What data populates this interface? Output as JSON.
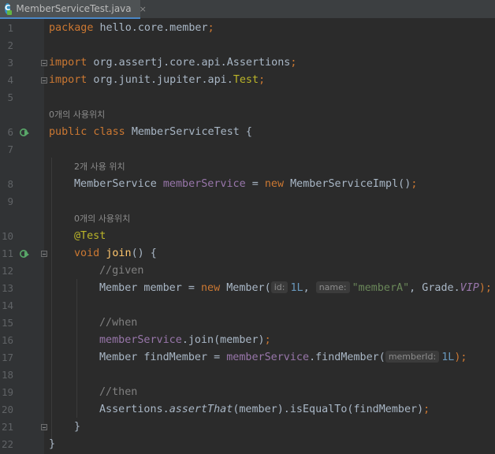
{
  "tab": {
    "title": "MemberServiceTest.java",
    "close": "×",
    "icon": "C"
  },
  "lines": {
    "n1": "1",
    "n2": "2",
    "n3": "3",
    "n4": "4",
    "n5": "5",
    "n6": "6",
    "n7": "7",
    "n8": "8",
    "n9": "9",
    "n10": "10",
    "n11": "11",
    "n12": "12",
    "n13": "13",
    "n14": "14",
    "n15": "15",
    "n16": "16",
    "n17": "17",
    "n18": "18",
    "n19": "19",
    "n20": "20",
    "n21": "21",
    "n22": "22"
  },
  "code": {
    "package_kw": "package",
    "package_name": " hello.core.member",
    "import_kw": "import",
    "import1": " org.assertj.core.api.Assertions",
    "import2_pkg": " org.junit.jupiter.api.",
    "import2_cls": "Test",
    "semi": ";",
    "usage_class": "0개의 사용위치",
    "public_class": "public class ",
    "class_name": "MemberServiceTest {",
    "usage_field": "2개 사용 위치",
    "field_type": "MemberService ",
    "field_name": "memberService",
    "eq": " = ",
    "new_kw": "new ",
    "impl": "MemberServiceImpl()",
    "usage_method": "0개의 사용위치",
    "annotation": "@Test",
    "void_kw": "void ",
    "method_name": "join",
    "method_rest": "() {",
    "c_given": "//given",
    "member_decl": "Member member = ",
    "member_ctor": "Member(",
    "hint_id": "id:",
    "val_1L": "1L",
    "comma": ", ",
    "hint_name": "name:",
    "val_memberA": "\"memberA\"",
    "grade": ", Grade.",
    "vip": "VIP",
    "close_paren_semi": ");",
    "c_when": "//when",
    "join_call": ".join(member)",
    "find_decl": "Member findMember = ",
    "find_call": ".findMember(",
    "hint_memberId": "memberId:",
    "c_then": "//then",
    "assertions": "Assertions.",
    "assert_that": "assertThat",
    "assert_rest": "(member).isEqualTo(findMember)",
    "close_brace": "}"
  },
  "colors": {
    "background": "#2b2b2b",
    "keyword": "#cc7832",
    "field": "#9876aa",
    "annotation": "#bbb529",
    "string": "#6a8759",
    "number": "#6897bb",
    "comment": "#808080"
  }
}
